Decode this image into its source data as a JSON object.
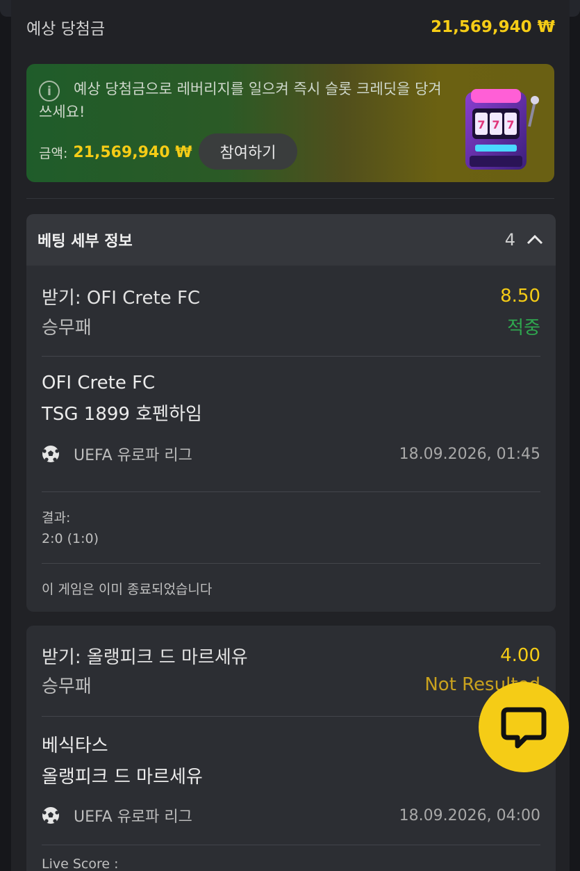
{
  "estimated_win": {
    "label": "예상 당첨금",
    "value": "21,569,940 ₩"
  },
  "promo": {
    "info_icon": "info-icon",
    "text": "예상 당첨금으로 레버리지를 일으켜 즉시 슬롯 크레딧을 당겨 쓰세요!",
    "amount_label": "금액:",
    "amount_value": "21,569,940 ₩",
    "join_label": "참여하기",
    "image": "slot-machine-icon"
  },
  "bet_details": {
    "title": "베팅 세부 정보",
    "count": "4",
    "toggle_icon": "chevron-up-icon"
  },
  "bets": [
    {
      "pick": "받기: OFI Crete FC",
      "odds": "8.50",
      "market": "승무패",
      "status": "적중",
      "team1": "OFI Crete FC",
      "team2": "TSG 1899 호펜하임",
      "league": "UEFA 유로파 리그",
      "datetime": "18.09.2026, 01:45",
      "result_label": "결과:",
      "result_value": "2:0 (1:0)",
      "note": "이 게임은 이미 종료되었습니다"
    },
    {
      "pick": "받기: 올랭피크 드 마르세유",
      "odds": "4.00",
      "market": "승무패",
      "status": "Not Resulted",
      "team1": "베식타스",
      "team2": "올랭피크 드 마르세유",
      "league": "UEFA 유로파 리그",
      "datetime": "18.09.2026, 04:00",
      "live_label": "Live Score :"
    }
  ],
  "colors": {
    "accent": "#f5cc16",
    "won": "#2fa84f",
    "pending": "#c9a21e"
  },
  "chat": {
    "icon": "chat-bubble-icon"
  }
}
